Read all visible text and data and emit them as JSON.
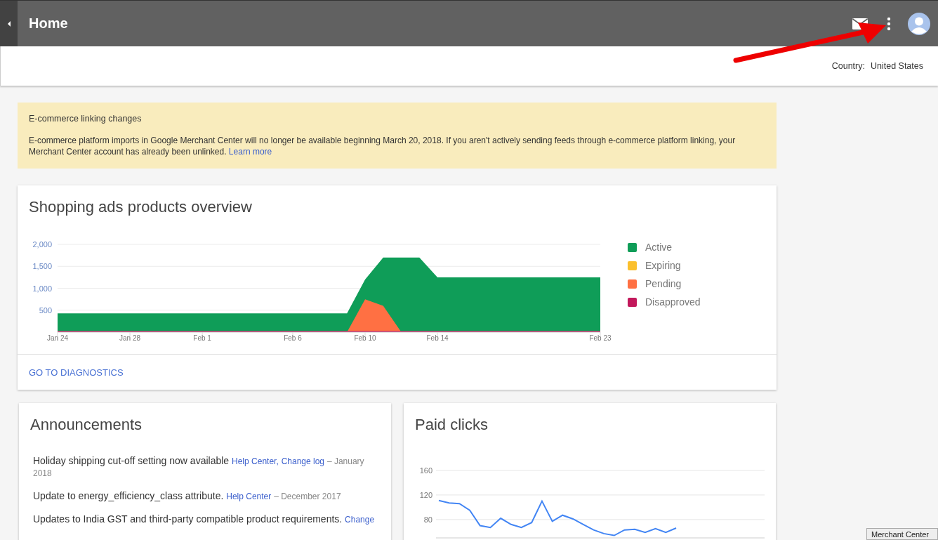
{
  "header": {
    "title": "Home"
  },
  "country": {
    "label": "Country:",
    "value": "United States"
  },
  "banner": {
    "title": "E-commerce linking changes",
    "message": "E-commerce platform imports in Google Merchant Center will no longer be available beginning March 20, 2018. If you aren't actively sending feeds through e-commerce platform linking, your Merchant Center account has already been unlinked.",
    "link": "Learn more"
  },
  "overview": {
    "title": "Shopping ads products overview",
    "action": "GO TO DIAGNOSTICS",
    "chart_data": {
      "type": "area",
      "categories": [
        "Jan 24",
        null,
        null,
        null,
        "Jan 28",
        null,
        null,
        null,
        "Feb 1",
        null,
        null,
        null,
        null,
        "Feb 6",
        null,
        null,
        null,
        "Feb 10",
        null,
        null,
        null,
        "Feb 14",
        null,
        null,
        null,
        null,
        null,
        null,
        null,
        null,
        "Feb 23"
      ],
      "series": [
        {
          "name": "Active",
          "color": "#0f9d58",
          "values": [
            430,
            430,
            430,
            430,
            430,
            430,
            430,
            430,
            430,
            430,
            430,
            430,
            430,
            430,
            430,
            430,
            430,
            1200,
            1700,
            1700,
            1700,
            1250,
            1250,
            1250,
            1250,
            1250,
            1250,
            1250,
            1250,
            1250,
            1250
          ]
        },
        {
          "name": "Expiring",
          "color": "#fbc02d",
          "values": [
            null,
            null,
            null,
            null,
            null,
            null,
            null,
            null,
            null,
            null,
            null,
            null,
            null,
            null,
            null,
            null,
            null,
            null,
            null,
            null,
            null,
            null,
            null,
            null,
            null,
            null,
            null,
            null,
            null,
            null,
            null
          ]
        },
        {
          "name": "Pending",
          "color": "#ff7043",
          "values": [
            0,
            0,
            0,
            0,
            0,
            0,
            0,
            0,
            0,
            0,
            0,
            0,
            0,
            0,
            0,
            0,
            0,
            750,
            600,
            0,
            0,
            0,
            0,
            0,
            0,
            0,
            0,
            0,
            0,
            0,
            0
          ]
        },
        {
          "name": "Disapproved",
          "color": "#c2185b",
          "values": [
            30,
            30,
            30,
            30,
            30,
            30,
            30,
            30,
            30,
            30,
            30,
            30,
            30,
            30,
            30,
            30,
            30,
            30,
            30,
            30,
            30,
            30,
            30,
            30,
            30,
            30,
            30,
            30,
            30,
            30,
            30
          ]
        }
      ],
      "ylim": [
        0,
        2000
      ],
      "grid": true,
      "yticks": [
        {
          "value": 500,
          "label": "500"
        },
        {
          "value": 1000,
          "label": "1,000"
        },
        {
          "value": 1500,
          "label": "1,500"
        },
        {
          "value": 2000,
          "label": "2,000"
        }
      ]
    }
  },
  "announcements": {
    "title": "Announcements",
    "items": [
      {
        "text": "Holiday shipping cut-off setting now available",
        "links": [
          "Help Center,",
          "Change log"
        ],
        "date": "– January 2018"
      },
      {
        "text": "Update to energy_efficiency_class attribute.",
        "links": [
          "Help Center"
        ],
        "date": "– December 2017"
      },
      {
        "text": "Updates to India GST and third-party compatible product requirements.",
        "links": [
          "Change"
        ]
      }
    ]
  },
  "paid_clicks": {
    "title": "Paid clicks",
    "chart_data": {
      "type": "line",
      "categories": [
        null,
        null,
        null,
        null,
        null,
        null,
        null,
        null,
        null,
        null,
        null,
        null,
        null,
        null,
        null,
        null,
        null,
        null,
        null,
        null,
        null,
        null,
        null,
        null
      ],
      "values": [
        111,
        107,
        106,
        95,
        70,
        67,
        82,
        72,
        67,
        75,
        110,
        77,
        87,
        81,
        72,
        63,
        57,
        54,
        63,
        64,
        59,
        65,
        59,
        66
      ],
      "ylim": [
        50,
        160
      ],
      "yticks": [
        80,
        120,
        160
      ],
      "grid": true
    }
  },
  "footer_tab": {
    "label": "Merchant Center"
  }
}
